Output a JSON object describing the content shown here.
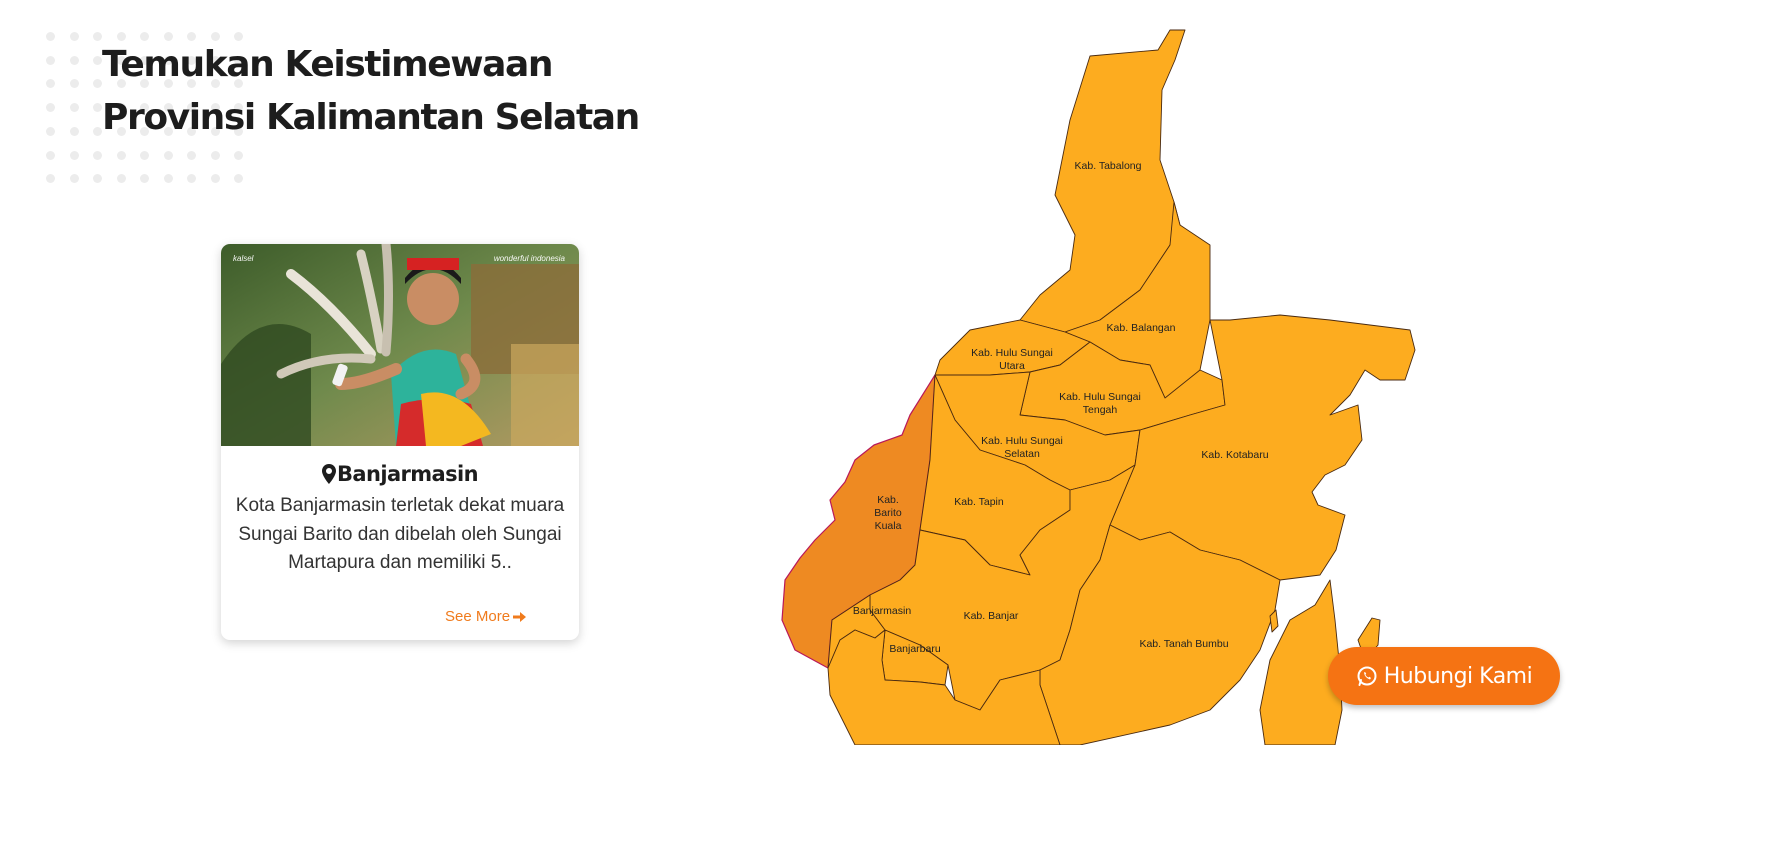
{
  "header": {
    "title_line1": "Temukan Keistimewaan",
    "title_line2": "Provinsi Kalimantan Selatan"
  },
  "card": {
    "image_name": "dancer-photo",
    "logo_left": "kalsel",
    "logo_right": "wonderful indonesia",
    "icon": "map-pin-icon",
    "title": "Banjarmasin",
    "description": "Kota Banjarmasin terletak dekat muara Sungai Barito dan dibelah oleh Sungai Martapura dan memiliki 5..",
    "see_more_label": "See More",
    "see_more_icon": "arrow-right-icon"
  },
  "map": {
    "regions": [
      {
        "name": "Kab. Tabalong",
        "selected": false
      },
      {
        "name": "Kab. Balangan",
        "selected": false
      },
      {
        "name": "Kab. Hulu Sungai Utara",
        "selected": false
      },
      {
        "name": "Kab. Hulu Sungai Tengah",
        "selected": false
      },
      {
        "name": "Kab. Hulu Sungai Selatan",
        "selected": false
      },
      {
        "name": "Kab. Kotabaru",
        "selected": false
      },
      {
        "name": "Kab. Tapin",
        "selected": false
      },
      {
        "name": "Kab. Barito Kuala",
        "selected": true
      },
      {
        "name": "Banjarmasin",
        "selected": false
      },
      {
        "name": "Kab. Banjar",
        "selected": false
      },
      {
        "name": "Banjarbaru",
        "selected": false
      },
      {
        "name": "Kab. Tanah Bumbu",
        "selected": false
      }
    ],
    "colors": {
      "region": "#fdac1f",
      "selected": "#ee8a22",
      "border": "#b8185a"
    }
  },
  "contact_button": {
    "label": "Hubungi Kami",
    "icon": "whatsapp-icon",
    "color": "#f57313"
  }
}
